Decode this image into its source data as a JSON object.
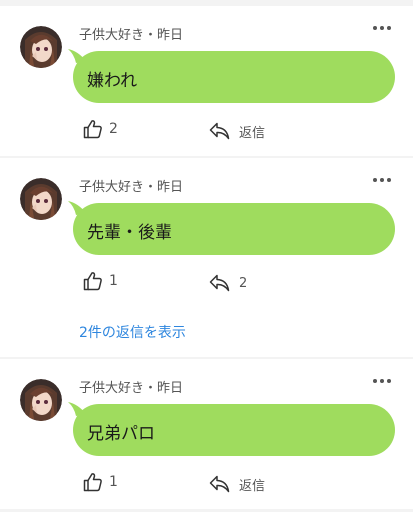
{
  "comments": [
    {
      "author": "子供大好き",
      "time": "昨日",
      "text": "嫌われ",
      "likes": "2",
      "reply_label": "返信"
    },
    {
      "author": "子供大好き",
      "time": "昨日",
      "text": "先輩・後輩",
      "likes": "1",
      "reply_label": "2",
      "show_replies": "2件の返信を表示"
    },
    {
      "author": "子供大好き",
      "time": "昨日",
      "text": "兄弟パロ",
      "likes": "1",
      "reply_label": "返信"
    }
  ],
  "colors": {
    "bubble": "#9fdc5e",
    "link": "#2e86de",
    "divider": "#f3f3f3"
  },
  "icons": [
    "avatar",
    "more-icon",
    "thumbs-up-icon",
    "reply-arrow-icon"
  ],
  "meta_separator": "・"
}
